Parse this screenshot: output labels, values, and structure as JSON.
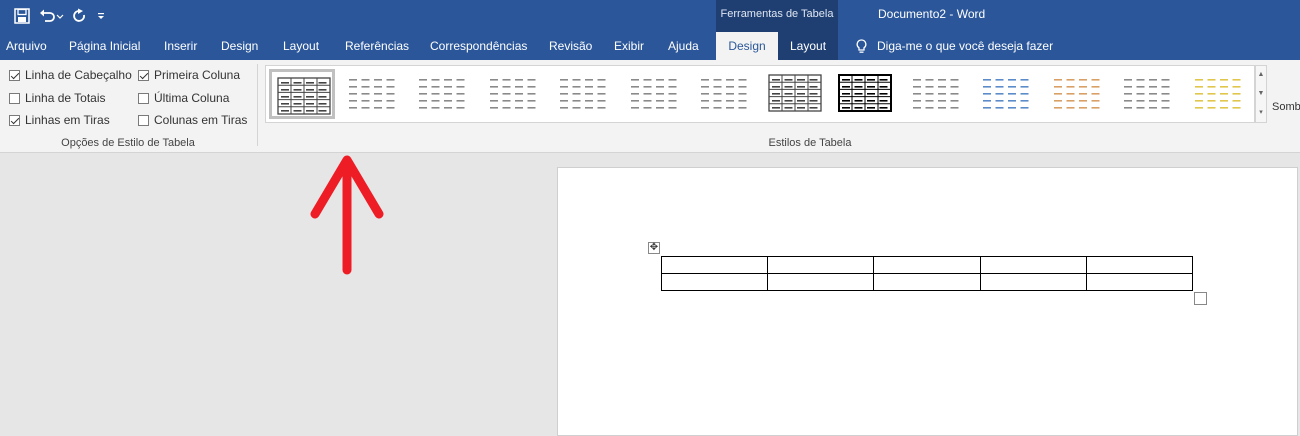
{
  "titlebar": {
    "context_title": "Ferramentas de Tabela",
    "document_title": "Documento2  -  Word"
  },
  "tabs": [
    {
      "label": "Arquivo"
    },
    {
      "label": "Página Inicial"
    },
    {
      "label": "Inserir"
    },
    {
      "label": "Design"
    },
    {
      "label": "Layout"
    },
    {
      "label": "Referências"
    },
    {
      "label": "Correspondências"
    },
    {
      "label": "Revisão"
    },
    {
      "label": "Exibir"
    },
    {
      "label": "Ajuda"
    },
    {
      "label": "Design"
    },
    {
      "label": "Layout"
    }
  ],
  "tell_me": {
    "label": "Diga-me o que você deseja fazer"
  },
  "style_options": {
    "group_label": "Opções de Estilo de Tabela",
    "items": [
      {
        "label": "Linha de Cabeçalho",
        "checked": true
      },
      {
        "label": "Primeira Coluna",
        "checked": true
      },
      {
        "label": "Linha de Totais",
        "checked": false
      },
      {
        "label": "Última Coluna",
        "checked": false
      },
      {
        "label": "Linhas em Tiras",
        "checked": true
      },
      {
        "label": "Colunas em Tiras",
        "checked": false
      }
    ]
  },
  "table_styles": {
    "group_label": "Estilos de Tabela",
    "selected_index": 0,
    "swatches": [
      "#444444",
      "#8a8a8a",
      "#8a8a8a",
      "#8a8a8a",
      "#8a8a8a",
      "#8a8a8a",
      "#8a8a8a",
      "#444444",
      "#000000",
      "#8a8a8a",
      "#5b8bc9",
      "#d9a066",
      "#8a8a8a",
      "#e0c64a"
    ]
  },
  "shading": {
    "label": "Somb"
  },
  "colors": {
    "ribbon_blue": "#2b579a",
    "context_blue": "#1f3f73",
    "arrow_red": "#ee1c24"
  },
  "document_table": {
    "rows": 2,
    "cols": 5
  }
}
